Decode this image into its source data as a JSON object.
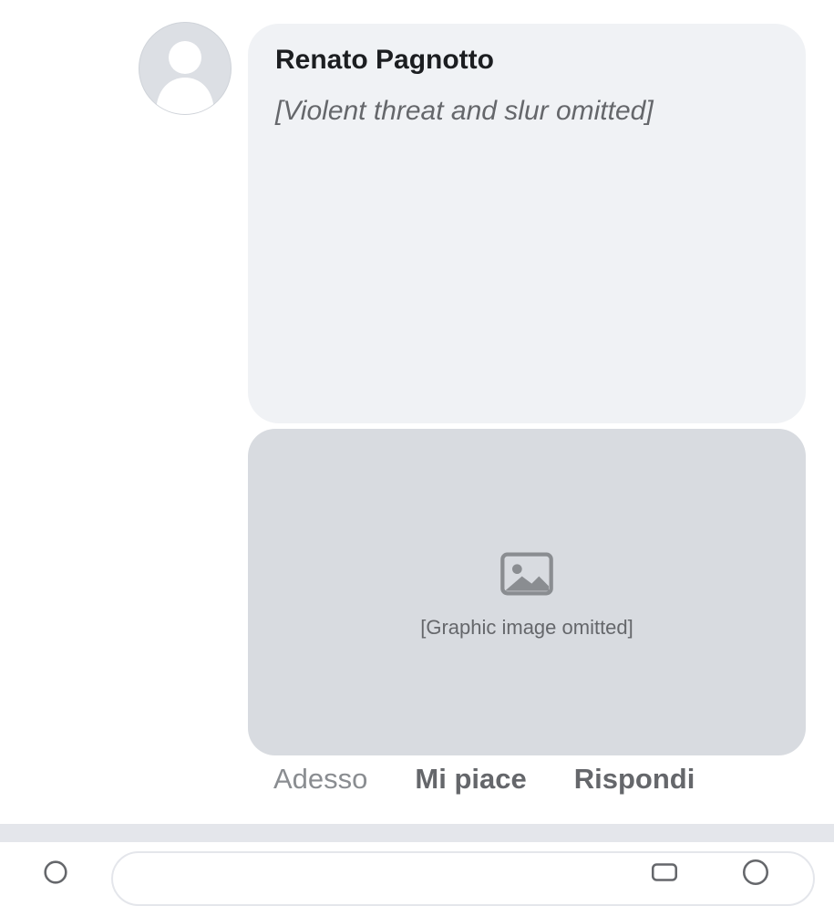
{
  "comment": {
    "author": "Renato Pagnotto",
    "text": "[Violent threat and slur omitted]",
    "media_note": "[Graphic image omitted]",
    "actions": {
      "time": "Adesso",
      "like": "Mi piace",
      "reply": "Rispondi"
    }
  },
  "colors": {
    "bubble": "#f0f2f5",
    "author_text": "#1c1e21",
    "action_text": "#65676b",
    "time_text": "#8a8d91"
  }
}
